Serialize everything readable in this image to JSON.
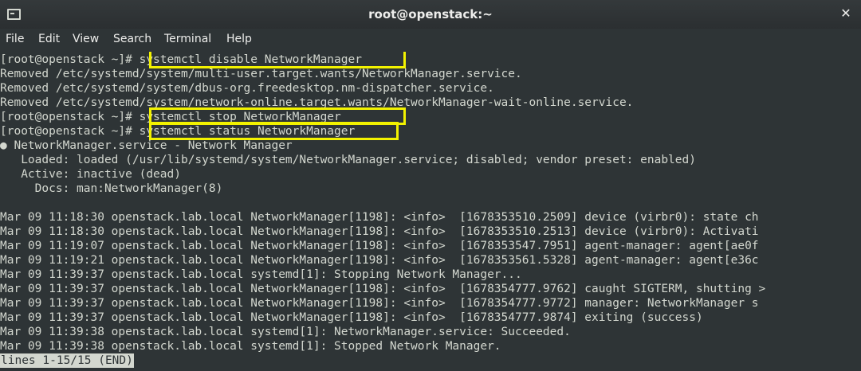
{
  "window": {
    "title": "root@openstack:~",
    "close_glyph": "✕",
    "icon": "terminal-icon"
  },
  "menu": [
    "File",
    "Edit",
    "View",
    "Search",
    "Terminal",
    "Help"
  ],
  "terminal": {
    "lines": [
      "[root@openstack ~]# systemctl disable NetworkManager",
      "Removed /etc/systemd/system/multi-user.target.wants/NetworkManager.service.",
      "Removed /etc/systemd/system/dbus-org.freedesktop.nm-dispatcher.service.",
      "Removed /etc/systemd/system/network-online.target.wants/NetworkManager-wait-online.service.",
      "[root@openstack ~]# systemctl stop NetworkManager",
      "[root@openstack ~]# systemctl status NetworkManager",
      "● NetworkManager.service - Network Manager",
      "   Loaded: loaded (/usr/lib/systemd/system/NetworkManager.service; disabled; vendor preset: enabled)",
      "   Active: inactive (dead)",
      "     Docs: man:NetworkManager(8)",
      "",
      "Mar 09 11:18:30 openstack.lab.local NetworkManager[1198]: <info>  [1678353510.2509] device (virbr0): state ch",
      "Mar 09 11:18:30 openstack.lab.local NetworkManager[1198]: <info>  [1678353510.2513] device (virbr0): Activati",
      "Mar 09 11:19:07 openstack.lab.local NetworkManager[1198]: <info>  [1678353547.7951] agent-manager: agent[ae0f",
      "Mar 09 11:19:21 openstack.lab.local NetworkManager[1198]: <info>  [1678353561.5328] agent-manager: agent[e36c",
      "Mar 09 11:39:37 openstack.lab.local systemd[1]: Stopping Network Manager...",
      "Mar 09 11:39:37 openstack.lab.local NetworkManager[1198]: <info>  [1678354777.9762] caught SIGTERM, shutting >",
      "Mar 09 11:39:37 openstack.lab.local NetworkManager[1198]: <info>  [1678354777.9772] manager: NetworkManager s",
      "Mar 09 11:39:37 openstack.lab.local NetworkManager[1198]: <info>  [1678354777.9874] exiting (success)",
      "Mar 09 11:39:38 openstack.lab.local systemd[1]: NetworkManager.service: Succeeded.",
      "Mar 09 11:39:38 openstack.lab.local systemd[1]: Stopped Network Manager."
    ],
    "pager_status": "lines 1-15/15 (END)",
    "highlight_color": "#f2f200"
  }
}
